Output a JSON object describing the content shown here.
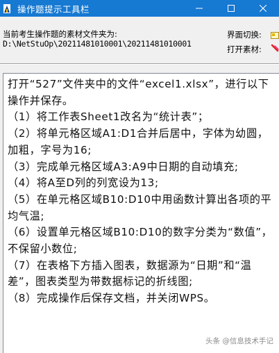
{
  "window": {
    "title": "操作题提示工具栏",
    "icons": [
      "app-icon",
      "minimize-icon",
      "restore-icon",
      "close-icon"
    ]
  },
  "header": {
    "path_label": "当前考生操作题的素材文件夹为:",
    "path_value": "D:\\NetStuOp\\20211481010001\\20211481010001",
    "switch_label": "界面切换:",
    "open_label": "打开素材:"
  },
  "task": {
    "text": "打开“527”文件夹中的文件“excel1.xlsx”，进行以下操作并保存。\n（1）将工作表Sheet1改名为“统计表”；\n（2）将单元格区域A1:D1合并后居中，字体为幼圆，加粗，字号为16;\n（3）完成单元格区域A3:A9中日期的自动填充;\n（4）将A至D列的列宽设为13;\n（5）在单元格区域B10:D10中用函数计算出各项的平均气温;\n（6）设置单元格区域B10:D10的数字分类为“数值”，不保留小数位;\n（7）在表格下方插入图表，数据源为“日期”和“温差”，图表类型为带数据标记的折线图;\n（8）完成操作后保存文档，并关闭WPS。"
  },
  "watermark": {
    "text": "头条 @信息技术手记"
  },
  "colors": {
    "titlebar": "#1679d2",
    "background": "#f0f0f0",
    "task_box": "#ffffff"
  }
}
